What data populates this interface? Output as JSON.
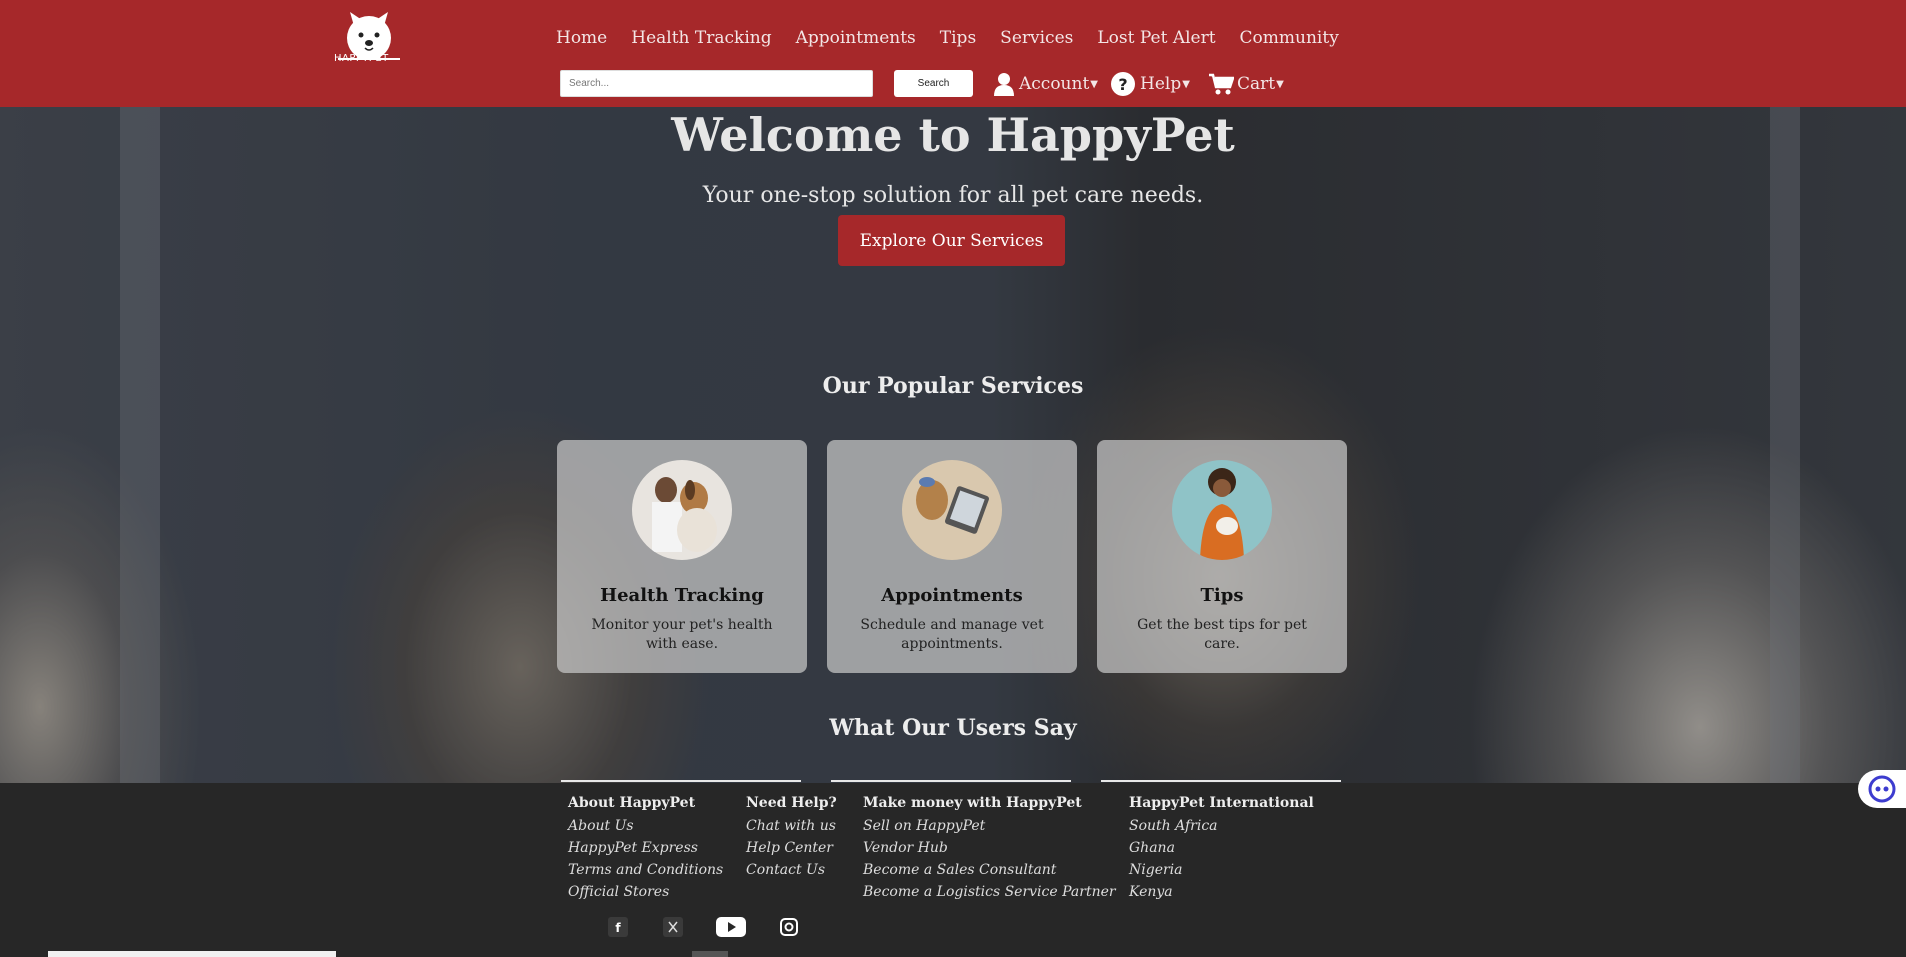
{
  "header": {
    "logo_text": "HAPPYPET",
    "nav": [
      "Home",
      "Health Tracking",
      "Appointments",
      "Tips",
      "Services",
      "Lost Pet Alert",
      "Community"
    ],
    "search_placeholder": "Search...",
    "search_button": "Search",
    "account_label": "Account",
    "help_label": "Help",
    "cart_label": "Cart",
    "brand_color": "#a6282a"
  },
  "hero": {
    "title": "Welcome to HappyPet",
    "subtitle": "Your one-stop solution for all pet care needs.",
    "cta": "Explore Our Services"
  },
  "services": {
    "title": "Our Popular Services",
    "cards": [
      {
        "title": "Health Tracking",
        "description": "Monitor your pet's health with ease."
      },
      {
        "title": "Appointments",
        "description": "Schedule and manage vet appointments."
      },
      {
        "title": "Tips",
        "description": "Get the best tips for pet care."
      }
    ]
  },
  "testimonials": {
    "title": "What Our Users Say"
  },
  "footer": {
    "columns": [
      {
        "heading": "About HappyPet",
        "links": [
          "About Us",
          "HappyPet Express",
          "Terms and Conditions",
          "Official Stores"
        ]
      },
      {
        "heading": "Need Help?",
        "links": [
          "Chat with us",
          "Help Center",
          "Contact Us"
        ]
      },
      {
        "heading": "Make money with HappyPet",
        "links": [
          "Sell on HappyPet",
          "Vendor Hub",
          "Become a Sales Consultant",
          "Become a Logistics Service Partner"
        ]
      },
      {
        "heading": "HappyPet International",
        "links": [
          "South Africa",
          "Ghana",
          "Nigeria",
          "Kenya"
        ]
      }
    ],
    "social_icons": [
      "facebook-icon",
      "x-icon",
      "youtube-icon",
      "instagram-icon"
    ]
  }
}
